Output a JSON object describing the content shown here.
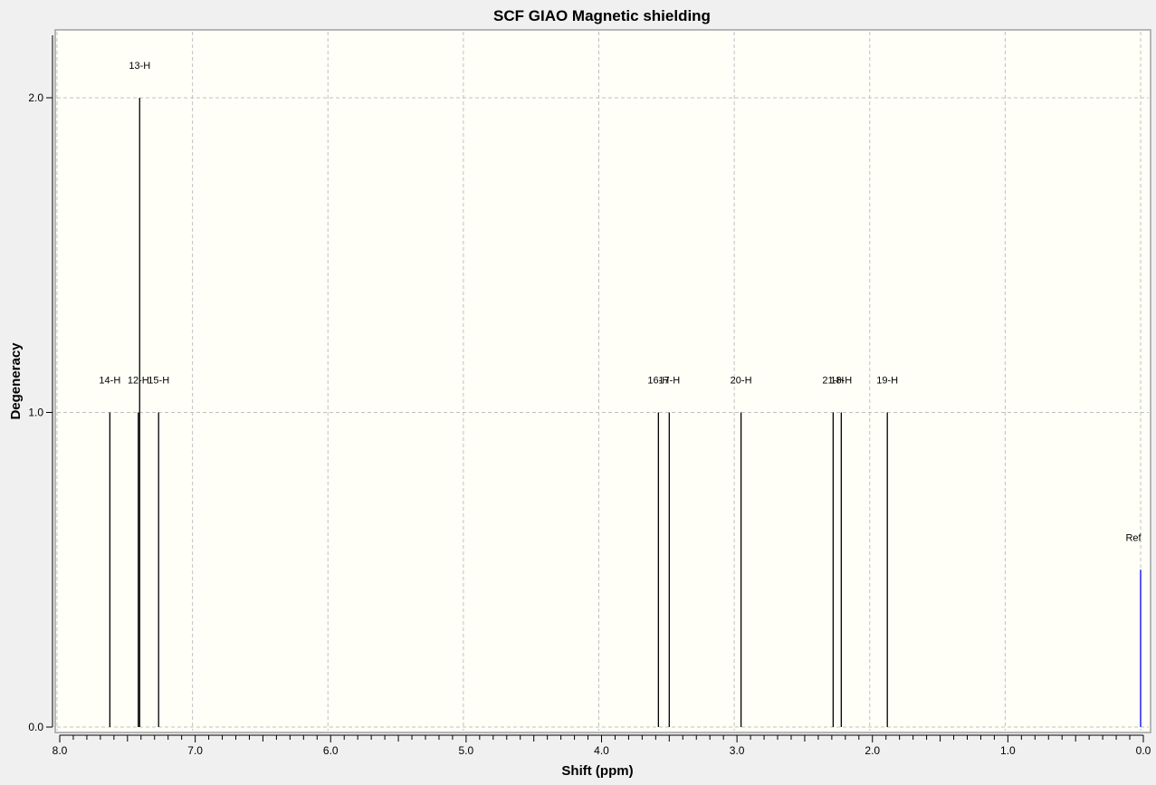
{
  "chart_data": {
    "type": "bar",
    "title": "SCF GIAO Magnetic shielding",
    "xlabel": "Shift (ppm)",
    "ylabel": "Degeneracy",
    "xlim": [
      8.0,
      0.0
    ],
    "ylim": [
      0.0,
      2.2
    ],
    "x_reversed": true,
    "grid": true,
    "xticks": [
      "8.0",
      "7.0",
      "6.0",
      "5.0",
      "4.0",
      "3.0",
      "2.0",
      "1.0",
      "0.0"
    ],
    "yticks": [
      "0.0",
      "1.0",
      "2.0"
    ],
    "peaks": [
      {
        "label": "14-H",
        "shift": 7.61,
        "degeneracy": 1
      },
      {
        "label": "12-H",
        "shift": 7.4,
        "degeneracy": 1
      },
      {
        "label": "13-H",
        "shift": 7.39,
        "degeneracy": 2
      },
      {
        "label": "15-H",
        "shift": 7.25,
        "degeneracy": 1
      },
      {
        "label": "16-H",
        "shift": 3.56,
        "degeneracy": 1
      },
      {
        "label": "17-H",
        "shift": 3.48,
        "degeneracy": 1
      },
      {
        "label": "20-H",
        "shift": 2.95,
        "degeneracy": 1
      },
      {
        "label": "21-H",
        "shift": 2.27,
        "degeneracy": 1
      },
      {
        "label": "18-H",
        "shift": 2.21,
        "degeneracy": 1
      },
      {
        "label": "19-H",
        "shift": 1.87,
        "degeneracy": 1
      },
      {
        "label": "Ref",
        "shift": 0.0,
        "degeneracy": 0.5,
        "color": "#0000ff"
      }
    ],
    "colors": {
      "peak": "#000000",
      "reference": "#0000ff",
      "plot_background": "#fffff8",
      "grid": "#c0c0c0"
    }
  }
}
